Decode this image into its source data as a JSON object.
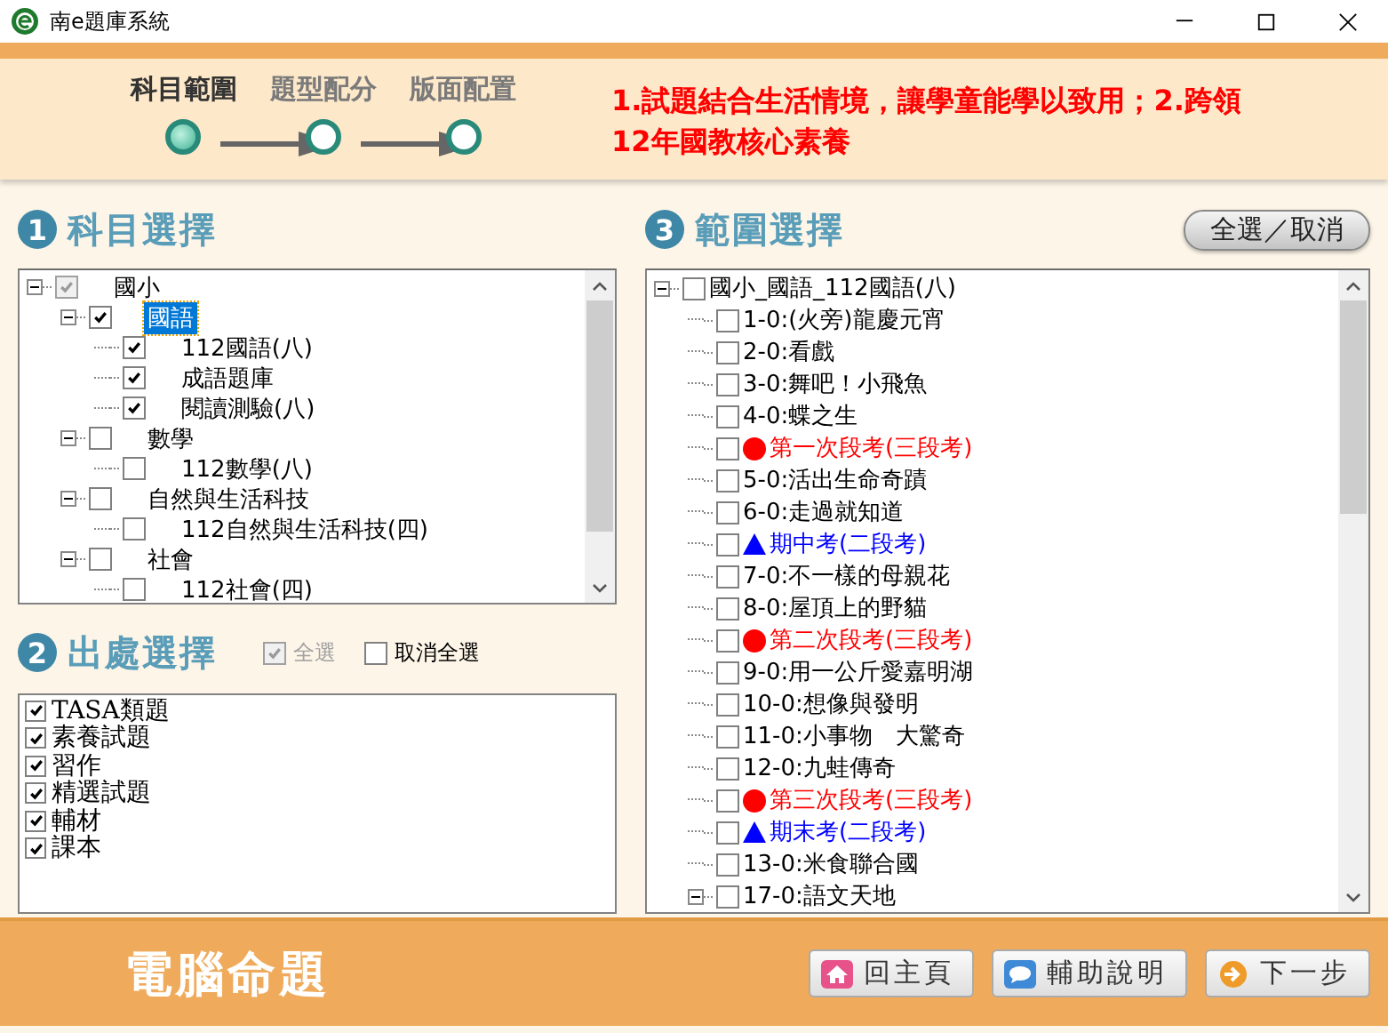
{
  "window": {
    "title": "南e題庫系統"
  },
  "steps": [
    {
      "label": "科目範圍",
      "selected": true
    },
    {
      "label": "題型配分",
      "selected": false
    },
    {
      "label": "版面配置",
      "selected": false
    }
  ],
  "notice": {
    "lines": [
      "1.試題結合生活情境，讓學童能學以致用；2.跨領",
      "12年國教核心素養"
    ]
  },
  "subjects": {
    "number": "1",
    "title": "科目選擇",
    "tree": [
      {
        "label": "國小",
        "checked": true,
        "partial": true,
        "selected": false,
        "expanded": true,
        "children": [
          {
            "label": "國語",
            "checked": true,
            "partial": false,
            "selected": true,
            "expanded": true,
            "children": [
              {
                "label": "112國語(八)",
                "checked": true,
                "partial": false,
                "selected": false
              },
              {
                "label": "成語題庫",
                "checked": true,
                "partial": false,
                "selected": false
              },
              {
                "label": "閱讀測驗(八)",
                "checked": true,
                "partial": false,
                "selected": false
              }
            ]
          },
          {
            "label": "數學",
            "checked": false,
            "partial": false,
            "selected": false,
            "expanded": true,
            "children": [
              {
                "label": "112數學(八)",
                "checked": false,
                "partial": false,
                "selected": false
              }
            ]
          },
          {
            "label": "自然與生活科技",
            "checked": false,
            "partial": false,
            "selected": false,
            "expanded": true,
            "children": [
              {
                "label": "112自然與生活科技(四)",
                "checked": false,
                "partial": false,
                "selected": false
              }
            ]
          },
          {
            "label": "社會",
            "checked": false,
            "partial": false,
            "selected": false,
            "expanded": true,
            "children": [
              {
                "label": "112社會(四)",
                "checked": false,
                "partial": false,
                "selected": false
              }
            ]
          }
        ]
      }
    ]
  },
  "sources": {
    "number": "2",
    "title": "出處選擇",
    "select_all": {
      "label": "全選",
      "checked": true,
      "disabled": true
    },
    "clear_all": {
      "label": "取消全選",
      "checked": false,
      "disabled": false
    },
    "items": [
      {
        "label": "TASA類題",
        "checked": true
      },
      {
        "label": "素養試題",
        "checked": true
      },
      {
        "label": "習作",
        "checked": true
      },
      {
        "label": "精選試題",
        "checked": true
      },
      {
        "label": "輔材",
        "checked": true
      },
      {
        "label": "課本",
        "checked": true
      }
    ]
  },
  "range": {
    "number": "3",
    "title": "範圍選擇",
    "toggle_button": "全選／取消",
    "tree": [
      {
        "label": "國小_國語_112國語(八)",
        "checked": false,
        "expanded": true,
        "children": [
          {
            "label": "1-0:(火旁)龍慶元宵",
            "kind": "lesson",
            "checked": false
          },
          {
            "label": "2-0:看戲",
            "kind": "lesson",
            "checked": false
          },
          {
            "label": "3-0:舞吧！小飛魚",
            "kind": "lesson",
            "checked": false
          },
          {
            "label": "4-0:蝶之生",
            "kind": "lesson",
            "checked": false
          },
          {
            "label": "第一次段考(三段考)",
            "kind": "term3",
            "checked": false
          },
          {
            "label": "5-0:活出生命奇蹟",
            "kind": "lesson",
            "checked": false
          },
          {
            "label": "6-0:走過就知道",
            "kind": "lesson",
            "checked": false
          },
          {
            "label": "期中考(二段考)",
            "kind": "term2",
            "checked": false
          },
          {
            "label": "7-0:不一樣的母親花",
            "kind": "lesson",
            "checked": false
          },
          {
            "label": "8-0:屋頂上的野貓",
            "kind": "lesson",
            "checked": false
          },
          {
            "label": "第二次段考(三段考)",
            "kind": "term3",
            "checked": false
          },
          {
            "label": "9-0:用一公斤愛嘉明湖",
            "kind": "lesson",
            "checked": false
          },
          {
            "label": "10-0:想像與發明",
            "kind": "lesson",
            "checked": false
          },
          {
            "label": "11-0:小事物　大驚奇",
            "kind": "lesson",
            "checked": false
          },
          {
            "label": "12-0:九蛙傳奇",
            "kind": "lesson",
            "checked": false
          },
          {
            "label": "第三次段考(三段考)",
            "kind": "term3",
            "checked": false
          },
          {
            "label": "期末考(二段考)",
            "kind": "term2",
            "checked": false
          },
          {
            "label": "13-0:米食聯合國",
            "kind": "lesson",
            "checked": false
          },
          {
            "label": "17-0:語文天地",
            "kind": "lesson",
            "checked": false,
            "expanded": true
          }
        ]
      }
    ]
  },
  "footer": {
    "title": "電腦命題",
    "buttons": [
      {
        "label": "回主頁",
        "kind": "home"
      },
      {
        "label": "輔助說明",
        "kind": "help"
      },
      {
        "label": "下一步",
        "kind": "next"
      }
    ]
  }
}
